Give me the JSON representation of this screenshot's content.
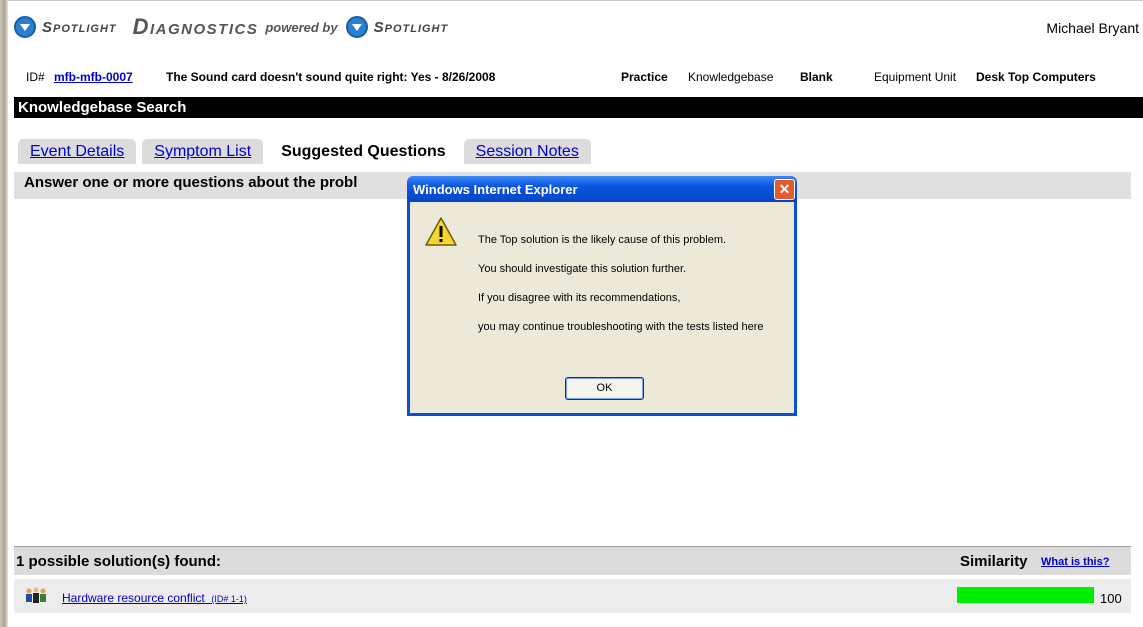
{
  "header": {
    "brand_small": "Spotlight",
    "brand_big": "Diagnostics",
    "powered_by": "powered by",
    "brand_small_2": "Spotlight",
    "user": "Michael Bryant"
  },
  "info": {
    "id_label": "ID#",
    "id_value": "mfb-mfb-0007",
    "event": "The Sound card doesn't sound quite right: Yes - 8/26/2008",
    "practice_label": "Practice",
    "kb_label": "Knowledgebase",
    "kb_value": "Blank",
    "equip_label": "Equipment Unit",
    "equip_value": "Desk Top Computers"
  },
  "kb_title": "Knowledgebase Search",
  "tabs": [
    {
      "label": "Event Details"
    },
    {
      "label": "Symptom List"
    },
    {
      "label": "Suggested Questions"
    },
    {
      "label": "Session Notes"
    }
  ],
  "answer_prompt": "Answer one or more questions about the probl",
  "solutions": {
    "title": "1 possible solution(s) found:",
    "similarity_label": "Similarity",
    "what_link": "What is this?",
    "items": [
      {
        "name": "Hardware resource conflict",
        "id": "(ID# 1-1)",
        "similarity": 100
      }
    ]
  },
  "dialog": {
    "title": "Windows Internet Explorer",
    "close": "✕",
    "lines": [
      "The Top solution is the likely cause of this problem.",
      "You should investigate this solution further.",
      "If you disagree with its recommendations,",
      "you may continue troubleshooting with the tests listed here"
    ],
    "ok": "OK"
  },
  "colors": {
    "similarity_bar": "#00ee00",
    "link": "#0000cc",
    "dialog_frame": "#0a4fd8"
  }
}
